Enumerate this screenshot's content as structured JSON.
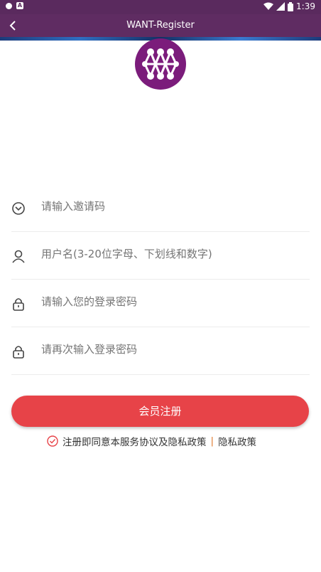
{
  "status_bar": {
    "time": "1:39"
  },
  "app_bar": {
    "title": "WANT-Register"
  },
  "form": {
    "invite_code": {
      "placeholder": "请输入邀请码"
    },
    "username": {
      "placeholder": "用户名(3-20位字母、下划线和数字)"
    },
    "password": {
      "placeholder": "请输入您的登录密码"
    },
    "confirm_password": {
      "placeholder": "请再次输入登录密码"
    }
  },
  "register_button": {
    "label": "会员注册"
  },
  "agreement": {
    "text": "注册即同意本服务协议及隐私政策",
    "separator": "|",
    "link": "隐私政策"
  },
  "colors": {
    "header": "#5f2c62",
    "logo": "#7b1c7b",
    "primary_button": "#e74348"
  }
}
